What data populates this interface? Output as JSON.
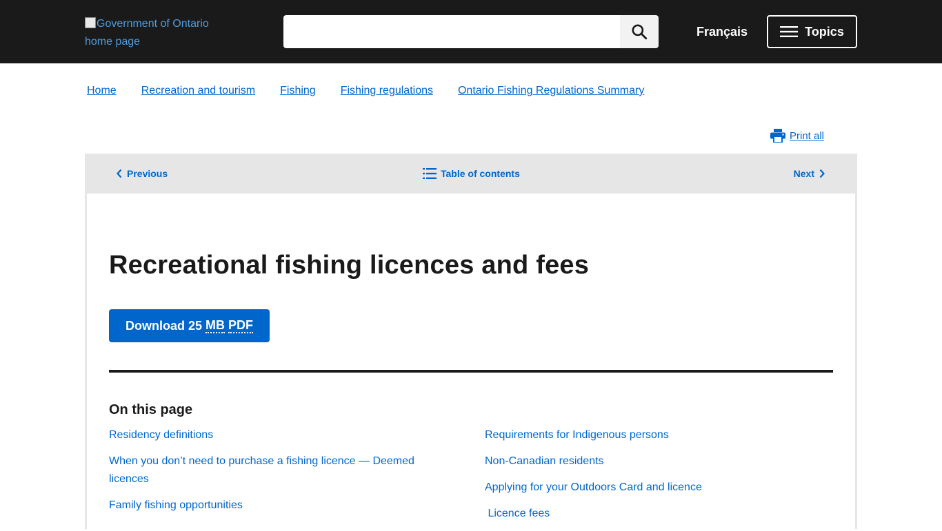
{
  "header": {
    "logo_alt": "Government of Ontario home page",
    "search": {
      "value": "",
      "placeholder": ""
    },
    "language_label": "Français",
    "topics_label": "Topics"
  },
  "breadcrumb": [
    "Home",
    "Recreation and tourism",
    "Fishing",
    "Fishing regulations",
    "Ontario Fishing Regulations Summary"
  ],
  "print_all_label": "Print all",
  "nav": {
    "previous_label": "Previous",
    "toc_label": "Table of contents",
    "next_label": "Next"
  },
  "page": {
    "title": "Recreational fishing licences and fees",
    "download": {
      "prefix": "Download 25",
      "unit": "MB",
      "format": "PDF"
    }
  },
  "on_this_page": {
    "heading": "On this page",
    "left": [
      "Residency definitions",
      "When you don’t need to purchase a fishing licence — Deemed licences",
      "Family fishing opportunities"
    ],
    "right": [
      "Requirements for Indigenous persons",
      "Non-Canadian residents",
      "Applying for your Outdoors Card and licence",
      " Licence fees"
    ]
  },
  "colors": {
    "header_bg": "#1a1a1a",
    "link": "#0066cc",
    "nav_bg": "#e6e6e6",
    "button": "#0066cc"
  },
  "icons": [
    "search-icon",
    "menu-icon",
    "printer-icon",
    "chevron-left-icon",
    "list-icon",
    "chevron-right-icon"
  ]
}
